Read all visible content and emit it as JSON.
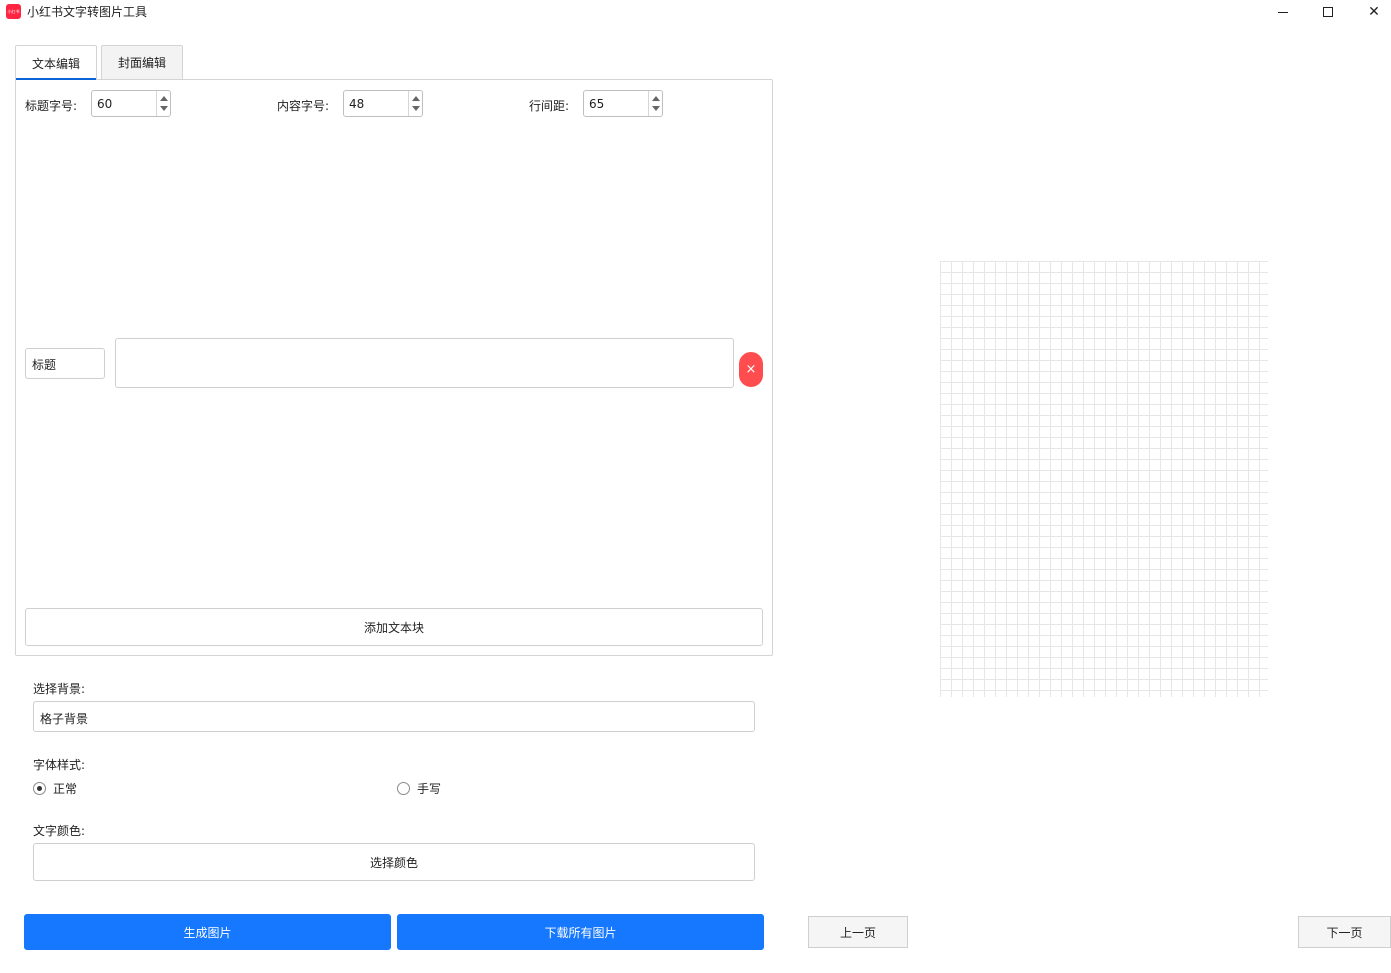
{
  "window": {
    "title": "小红书文字转图片工具",
    "icon_text": "小红书",
    "accent": "#ff2442"
  },
  "tabs": [
    {
      "label": "文本编辑",
      "active": true
    },
    {
      "label": "封面编辑",
      "active": false
    }
  ],
  "font_settings": {
    "title_size_label": "标题字号:",
    "title_size_value": "60",
    "content_size_label": "内容字号:",
    "content_size_value": "48",
    "line_spacing_label": "行间距:",
    "line_spacing_value": "65"
  },
  "text_block": {
    "type": "标题",
    "content": "",
    "delete_symbol": "×"
  },
  "add_block_label": "添加文本块",
  "background": {
    "label": "选择背景:",
    "selected": "格子背景"
  },
  "font_style": {
    "label": "字体样式:",
    "options": [
      {
        "label": "正常",
        "checked": true
      },
      {
        "label": "手写",
        "checked": false
      }
    ]
  },
  "text_color": {
    "label": "文字颜色:",
    "button_label": "选择颜色"
  },
  "actions": {
    "generate_label": "生成图片",
    "download_label": "下载所有图片",
    "primary_color": "#1677ff"
  },
  "pager": {
    "prev_label": "上一页",
    "next_label": "下一页"
  }
}
